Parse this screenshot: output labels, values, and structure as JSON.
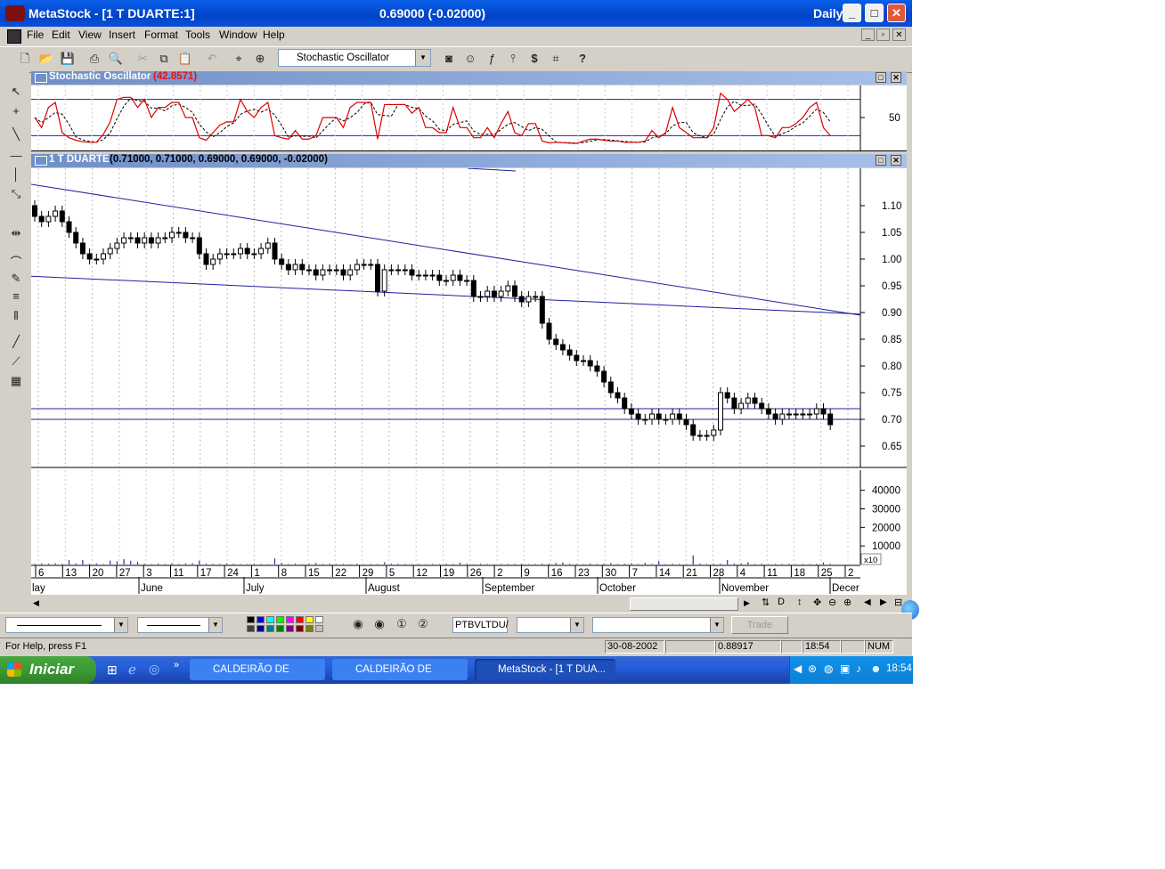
{
  "window": {
    "app_name": "MetaStock - [1 T DUARTE:1]",
    "quote": "0.69000 (-0.02000)",
    "period": "Daily",
    "minimize": "_",
    "maximize": "□",
    "close": "✕"
  },
  "menu": [
    "File",
    "Edit",
    "View",
    "Insert",
    "Format",
    "Tools",
    "Window",
    "Help"
  ],
  "mdi_controls": [
    "_",
    "▫",
    "✕"
  ],
  "toolbar": {
    "indicator": "Stochastic Oscillator",
    "icons": [
      "new-icon",
      "open-icon",
      "save-icon",
      "print-icon",
      "print-preview-icon",
      "cut-icon",
      "copy-icon",
      "paste-icon",
      "undo-icon",
      "crosshair-icon",
      "zoom-icon",
      "indicator-builder-icon",
      "expert-advisor-icon",
      "formula-icon",
      "system-tester-icon",
      "dollar-icon",
      "explorer-icon",
      "help-icon"
    ]
  },
  "stochastic_panel": {
    "title": "Stochastic Oscillator",
    "value": "(42.8571)",
    "axis_label": "50"
  },
  "price_panel": {
    "title": "1 T DUARTE",
    "values": "(0.71000, 0.71000, 0.69000, 0.69000, -0.02000)"
  },
  "chart_data": {
    "type": "candlestick",
    "security": "1 T DUARTE",
    "price_ticks": [
      1.1,
      1.05,
      1.0,
      0.95,
      0.9,
      0.85,
      0.8,
      0.75,
      0.7,
      0.65
    ],
    "price_tick_labels": [
      "1.10",
      "1.05",
      "1.00",
      "0.95",
      "0.90",
      "0.85",
      "0.80",
      "0.75",
      "0.70",
      "0.65"
    ],
    "ylim": [
      0.61,
      1.17
    ],
    "volume_ticks": [
      40000,
      30000,
      20000,
      10000
    ],
    "volume_tick_labels": [
      "40000",
      "30000",
      "20000",
      "10000"
    ],
    "volume_multiplier_label": "x10",
    "day_labels": [
      "6",
      "13",
      "20",
      "27",
      "3",
      "11",
      "17",
      "24",
      "1",
      "8",
      "15",
      "22",
      "29",
      "5",
      "12",
      "19",
      "26",
      "2",
      "9",
      "16",
      "23",
      "30",
      "7",
      "14",
      "21",
      "28",
      "4",
      "11",
      "18",
      "25",
      "2"
    ],
    "month_labels": [
      "lay",
      "June",
      "July",
      "August",
      "September",
      "October",
      "November",
      "Decer"
    ],
    "close": [
      1.08,
      1.07,
      1.08,
      1.09,
      1.07,
      1.05,
      1.03,
      1.01,
      1.0,
      1.0,
      1.01,
      1.02,
      1.03,
      1.04,
      1.04,
      1.03,
      1.04,
      1.03,
      1.04,
      1.04,
      1.05,
      1.05,
      1.04,
      1.04,
      1.01,
      0.99,
      1.0,
      1.01,
      1.01,
      1.01,
      1.02,
      1.01,
      1.01,
      1.02,
      1.03,
      1.0,
      0.99,
      0.98,
      0.99,
      0.98,
      0.98,
      0.97,
      0.98,
      0.98,
      0.98,
      0.97,
      0.98,
      0.99,
      0.99,
      0.99,
      0.94,
      0.98,
      0.98,
      0.98,
      0.98,
      0.97,
      0.97,
      0.97,
      0.97,
      0.96,
      0.96,
      0.97,
      0.96,
      0.96,
      0.93,
      0.93,
      0.94,
      0.93,
      0.94,
      0.95,
      0.93,
      0.92,
      0.93,
      0.93,
      0.88,
      0.85,
      0.84,
      0.83,
      0.82,
      0.81,
      0.81,
      0.8,
      0.79,
      0.77,
      0.75,
      0.74,
      0.72,
      0.71,
      0.7,
      0.7,
      0.71,
      0.7,
      0.7,
      0.71,
      0.7,
      0.69,
      0.67,
      0.67,
      0.67,
      0.68,
      0.75,
      0.74,
      0.72,
      0.73,
      0.74,
      0.73,
      0.72,
      0.71,
      0.7,
      0.71,
      0.71,
      0.71,
      0.71,
      0.71,
      0.72,
      0.71,
      0.69
    ],
    "volume_scaled_x10": [
      400,
      600,
      500,
      700,
      400,
      2400,
      600,
      2400,
      400,
      600,
      300,
      2100,
      1700,
      2900,
      2000,
      1400,
      500,
      200,
      500,
      300,
      700,
      300,
      600,
      700,
      2100,
      500,
      400,
      300,
      600,
      400,
      300,
      200,
      400,
      300,
      200,
      3300,
      900,
      300,
      500,
      200,
      400,
      900,
      300,
      400,
      200,
      300,
      200,
      400,
      200,
      300,
      300,
      1200,
      400,
      400,
      300,
      200,
      300,
      200,
      300,
      200,
      400,
      300,
      1000,
      400,
      200,
      400,
      300,
      200,
      300,
      300,
      400,
      500,
      200,
      300,
      400,
      500,
      900,
      1200,
      400,
      300,
      200,
      500,
      300,
      400,
      800,
      300,
      400,
      600,
      300,
      900,
      300,
      1800,
      200,
      400,
      300,
      300,
      4900,
      500,
      300,
      400,
      400,
      2400,
      500,
      600,
      1200,
      300,
      400,
      200,
      300,
      300,
      400,
      200,
      300,
      300,
      400,
      1100,
      400
    ]
  },
  "bottom": {
    "symbol": "PTBVLTDU/",
    "trade": "Trade"
  },
  "status": {
    "help": "For Help, press F1",
    "date": "30-08-2002",
    "value": "0.88917",
    "time": "18:54",
    "num": "NUM"
  },
  "taskbar": {
    "start": "Iniciar",
    "tasks": [
      "CALDEIRÃO DE BOLS...",
      "CALDEIRÃO DE BOLS...",
      "MetaStock - [1 T DUA..."
    ],
    "clock": "18:54"
  },
  "colors": {
    "titlebar": "#0a5ee8",
    "panel_header": "#6f8fc8",
    "trendline": "#2020a0",
    "stoch_k": "#dd0000",
    "value_red": "#ee1111"
  }
}
